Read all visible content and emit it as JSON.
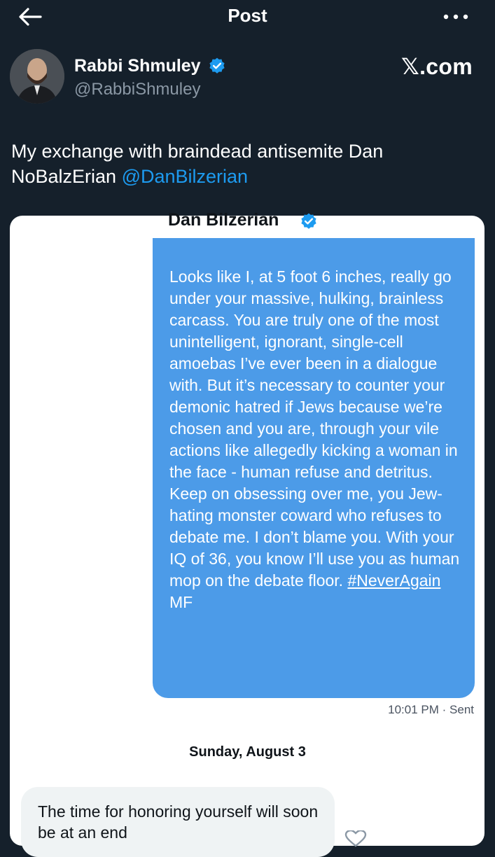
{
  "topbar": {
    "title": "Post"
  },
  "author": {
    "name": "Rabbi Shmuley",
    "handle": "@RabbiShmuley",
    "verified": true
  },
  "watermark": "𝕏.com",
  "tweet": {
    "text": "My exchange with braindead antisemite Dan NoBalzErian ",
    "mention": "@DanBilzerian"
  },
  "dm": {
    "contact_name": "Dan Bilzerian",
    "sent_message": "Looks like I, at 5 foot 6 inches, really go under your massive, hulking, brainless carcass.  You are truly one of the most unintelligent, ignorant, single-cell amoebas I’ve ever been in a dialogue with. But it’s necessary to counter your demonic hatred if Jews because we’re chosen and you are, through your vile actions like allegedly kicking a woman in the face - human refuse and detritus. Keep on obsessing over me, you Jew-hating monster coward who refuses to debate me. I don’t blame you. With your IQ of 36, you know I’ll use you as human mop on the debate floor. ",
    "sent_hashtag": "#NeverAgain",
    "sent_suffix": " MF",
    "sent_time": "10:01 PM",
    "sent_status": "· Sent",
    "date_separator": "Sunday, August 3",
    "received_message": "The time for honoring yourself will soon be at an end"
  },
  "colors": {
    "background": "#15202b",
    "accent": "#1d9bf0",
    "sent_bubble": "#4c9be8",
    "received_bubble": "#eff3f4"
  }
}
